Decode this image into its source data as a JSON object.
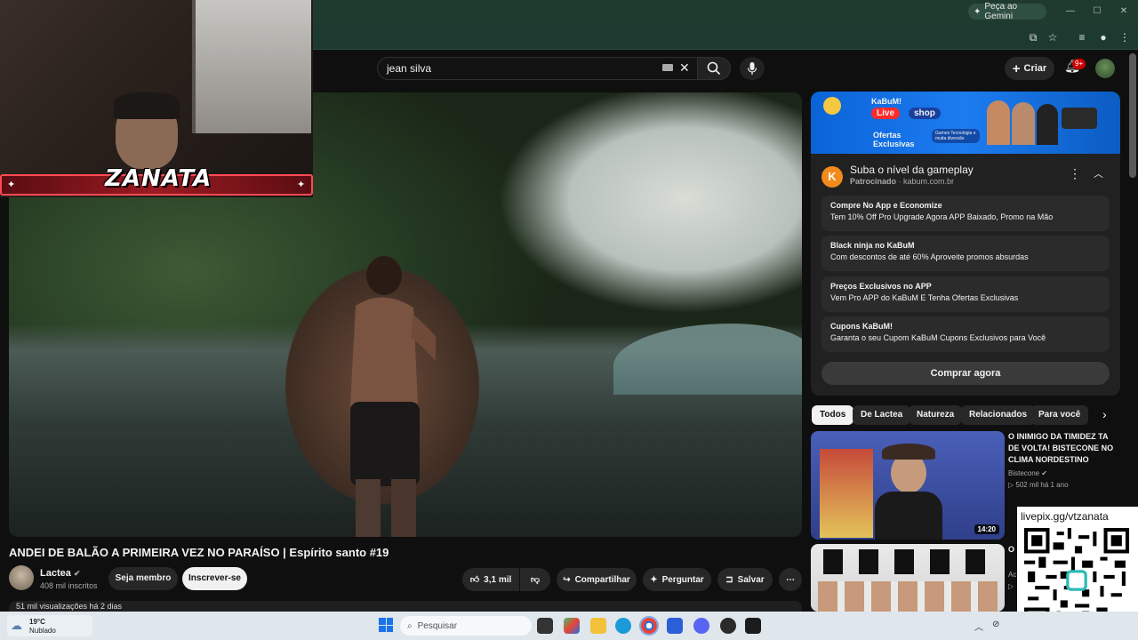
{
  "browser": {
    "gemini_label": "Peça ao Gemini",
    "window_controls": [
      "—",
      "☐",
      "✕"
    ]
  },
  "youtube": {
    "search_value": "jean silva",
    "create_label": "Criar",
    "notification_badge": "9+"
  },
  "overlay": {
    "streamer_name": "ZANATA"
  },
  "video": {
    "title": "ANDEI DE BALÃO A PRIMEIRA VEZ NO PARAÍSO | Espírito santo #19",
    "channel": "Lactea",
    "subscribers": "408 mil inscritos",
    "member_label": "Seja membro",
    "subscribe_label": "Inscrever-se",
    "likes": "3,1 mil",
    "share_label": "Compartilhar",
    "ask_label": "Perguntar",
    "save_label": "Salvar",
    "views_line": "51 mil visualizações  há 2 dias"
  },
  "ad": {
    "banner_brand": "KaBuM!",
    "banner_live": "Live",
    "banner_shop": "shop",
    "banner_offers": "Ofertas Exclusivas",
    "banner_games": "Games Tecnologia e muita diversão",
    "title": "Suba o nível da gameplay",
    "sponsored": "Patrocinado",
    "domain": "kabum.com.br",
    "links": [
      {
        "title": "Compre No App e Economize",
        "desc": "Tem 10% Off Pro Upgrade Agora APP Baixado, Promo na Mão"
      },
      {
        "title": "Black ninja no KaBuM",
        "desc": "Com descontos de até 60% Aproveite promos absurdas"
      },
      {
        "title": "Preços Exclusivos no APP",
        "desc": "Vem Pro APP do KaBuM E Tenha Ofertas Exclusivas"
      },
      {
        "title": "Cupons KaBuM!",
        "desc": "Garanta o seu Cupom KaBuM Cupons Exclusivos para Você"
      }
    ],
    "cta": "Comprar agora"
  },
  "chips": [
    "Todos",
    "De Lactea",
    "Natureza",
    "Relacionados",
    "Para você"
  ],
  "recommendations": [
    {
      "title": "O INIMIGO DA TIMIDEZ TA DE VOLTA! BISTECONE NO CLIMA NORDESTINO",
      "channel": "Bistecone",
      "meta": "▷ 502 mil  há 1 ano",
      "duration": "14:20"
    },
    {
      "title": "O M",
      "channel": "Ac",
      "meta": "▷",
      "duration": ""
    }
  ],
  "livepix": "livepix.gg/vtzanata",
  "taskbar": {
    "temp": "19°C",
    "condition": "Nublado",
    "search_placeholder": "Pesquisar"
  },
  "colors": {
    "yt_bg": "#0f0f0f",
    "browser_green": "#1f3b30",
    "accent_red": "#cc0000",
    "kabum_blue": "#0a64d8",
    "kabum_orange": "#f28a1c"
  }
}
